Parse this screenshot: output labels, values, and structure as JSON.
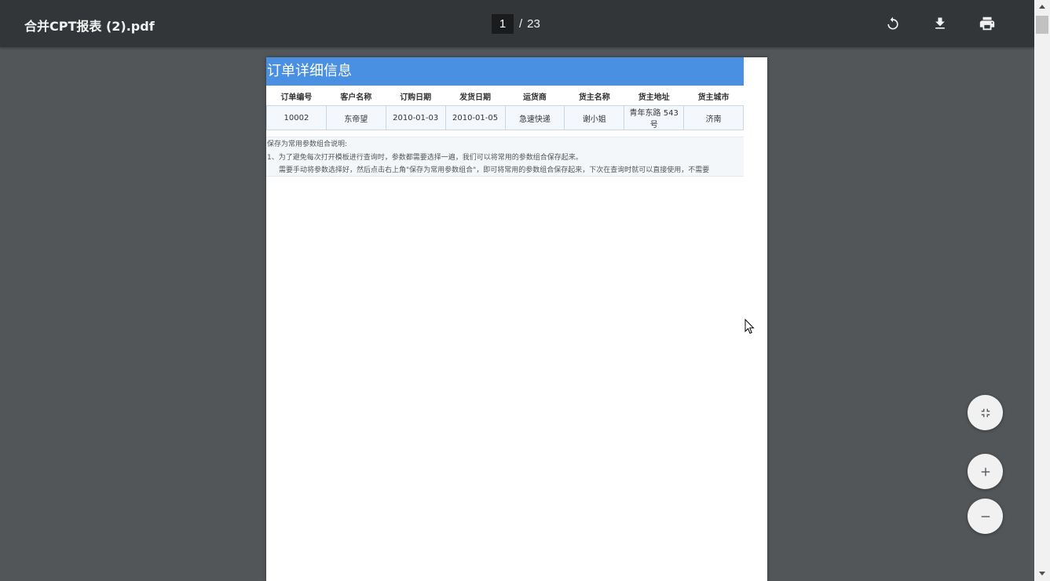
{
  "viewer": {
    "title": "合并CPT报表 (2).pdf",
    "current_page": "1",
    "separator": "/",
    "total_pages": "23"
  },
  "toolbar": {
    "rotate_icon": "rotate-icon",
    "download_icon": "download-icon",
    "print_icon": "print-icon"
  },
  "report": {
    "title": "订单详细信息",
    "columns": [
      "订单编号",
      "客户名称",
      "订购日期",
      "发货日期",
      "运货商",
      "货主名称",
      "货主地址",
      "货主城市"
    ],
    "rows": [
      [
        "10002",
        "东帝望",
        "2010-01-03",
        "2010-01-05",
        "急速快递",
        "谢小姐",
        "青年东路 543 号",
        "济南"
      ]
    ],
    "notes": {
      "heading": "保存为常用参数组合说明:",
      "line1": "1、为了避免每次打开模板进行查询时，参数都需要选择一遍，我们可以将常用的参数组合保存起来。",
      "line2": "需要手动将参数选择好，然后点击右上角\"保存为常用参数组合\"，即可将常用的参数组合保存起来，下次在查询时就可以直接使用，不需要"
    }
  },
  "zoom_controls": {
    "fit_icon": "fit-to-page-icon",
    "zoom_in_icon": "plus-icon",
    "zoom_out_icon": "minus-icon"
  },
  "colors": {
    "toolbar_bg": "#323639",
    "viewer_bg": "#525659",
    "title_bar_blue": "#4a90e2"
  }
}
